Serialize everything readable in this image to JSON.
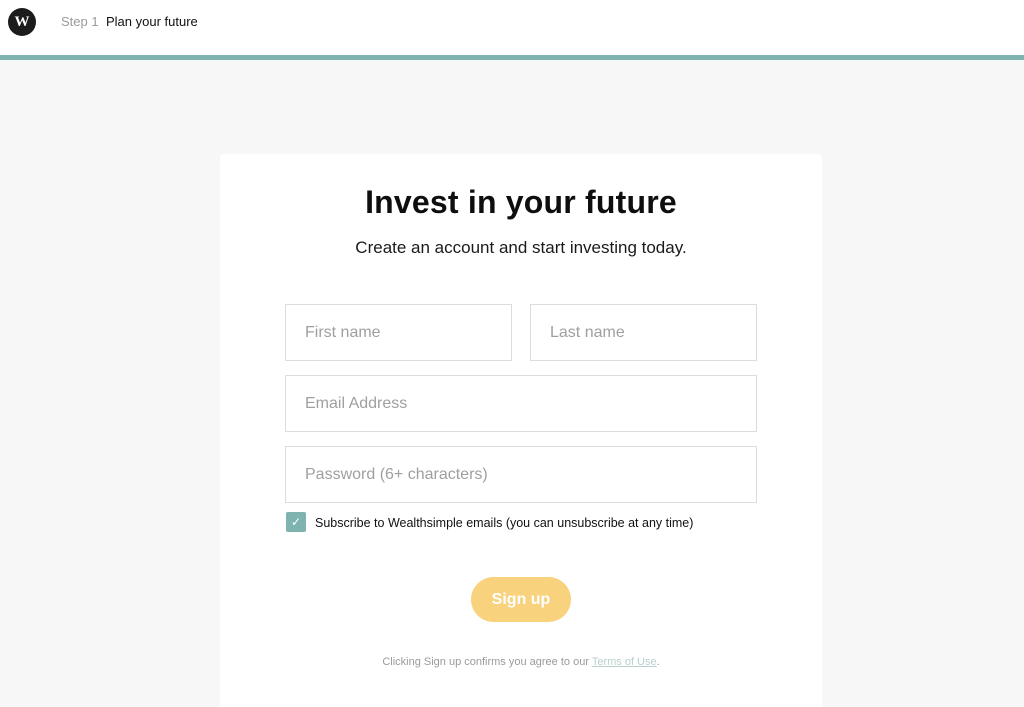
{
  "header": {
    "logo_letter": "W",
    "step_label": "Step 1",
    "step_title": "Plan your future"
  },
  "form": {
    "title": "Invest in your future",
    "subtitle": "Create an account and start investing today.",
    "first_name": {
      "value": "",
      "placeholder": "First name"
    },
    "last_name": {
      "value": "",
      "placeholder": "Last name"
    },
    "email": {
      "value": "",
      "placeholder": "Email Address"
    },
    "password": {
      "value": "",
      "placeholder": "Password (6+ characters)"
    },
    "subscribe": {
      "checked": true,
      "label": "Subscribe to Wealthsimple emails (you can unsubscribe at any time)"
    },
    "signup_label": "Sign up",
    "terms_prefix": "Clicking Sign up confirms you agree to our ",
    "terms_link": "Terms of Use",
    "terms_suffix": "."
  },
  "colors": {
    "accent": "#7fb3b0",
    "button": "#f9d27e",
    "background": "#f8f7f7"
  },
  "icons": {
    "logo": "wealthsimple-logo-icon",
    "checkbox": "checkmark-icon"
  }
}
